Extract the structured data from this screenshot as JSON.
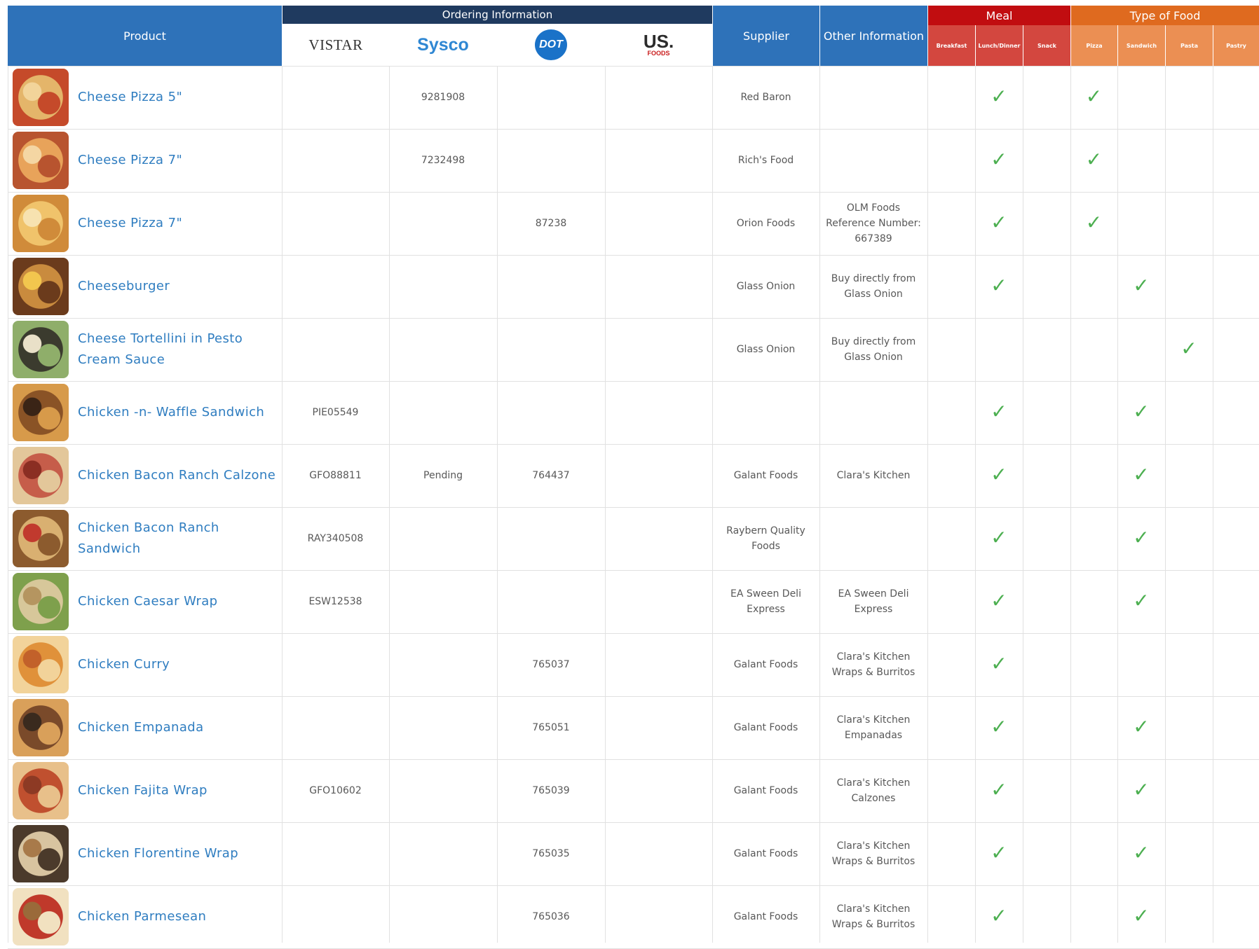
{
  "header": {
    "product": "Product",
    "ordering_information": "Ordering Information",
    "supplier": "Supplier",
    "other_information": "Other Information",
    "meal": "Meal",
    "type_of_food": "Type of Food",
    "vendors": {
      "vistar": "VISTAR",
      "sysco": "Sysco",
      "dot": "DOT",
      "usfoods_top": "US.",
      "usfoods_bottom": "FOODS"
    },
    "meal_columns": [
      "Breakfast",
      "Lunch/Dinner",
      "Snack"
    ],
    "food_columns": [
      "Pizza",
      "Sandwich",
      "Pasta",
      "Pastry"
    ]
  },
  "colors": {
    "blue_header": "#2e72b9",
    "dark_header": "#1f3a5f",
    "meal_red": "#c10d10",
    "food_orange": "#df6a1f",
    "product_text": "#2f7dc0",
    "check_green": "#4caf50"
  },
  "check_mark": "✓",
  "rows": [
    {
      "product": "Cheese Pizza 5\"",
      "image": "cheese-pizza-5-photo",
      "vistar": "",
      "sysco": "9281908",
      "dot": "",
      "usfoods": "",
      "supplier": "Red Baron",
      "other": "",
      "meal": [
        false,
        true,
        false
      ],
      "food": [
        true,
        false,
        false,
        false
      ]
    },
    {
      "product": "Cheese Pizza 7\"",
      "image": "cheese-pizza-7-photo",
      "vistar": "",
      "sysco": "7232498",
      "dot": "",
      "usfoods": "",
      "supplier": "Rich's Food",
      "other": "",
      "meal": [
        false,
        true,
        false
      ],
      "food": [
        true,
        false,
        false,
        false
      ]
    },
    {
      "product": "Cheese Pizza 7\"",
      "image": "cheese-pizza-7-slices-photo",
      "vistar": "",
      "sysco": "",
      "dot": "87238",
      "usfoods": "",
      "supplier": "Orion Foods",
      "other": "OLM Foods\nReference Number:\n667389",
      "meal": [
        false,
        true,
        false
      ],
      "food": [
        true,
        false,
        false,
        false
      ]
    },
    {
      "product": "Cheeseburger",
      "image": "cheeseburger-photo",
      "vistar": "",
      "sysco": "",
      "dot": "",
      "usfoods": "",
      "supplier": "Glass Onion",
      "other": "Buy directly from\nGlass Onion",
      "meal": [
        false,
        true,
        false
      ],
      "food": [
        false,
        true,
        false,
        false
      ]
    },
    {
      "product": "Cheese Tortellini in Pesto\nCream Sauce",
      "image": "tortellini-photo",
      "vistar": "",
      "sysco": "",
      "dot": "",
      "usfoods": "",
      "supplier": "Glass Onion",
      "other": "Buy directly from\nGlass Onion",
      "meal": [
        false,
        false,
        false
      ],
      "food": [
        false,
        false,
        true,
        false
      ]
    },
    {
      "product": "Chicken -n- Waffle Sandwich",
      "image": "chicken-waffle-photo",
      "vistar": "PIE05549",
      "sysco": "",
      "dot": "",
      "usfoods": "",
      "supplier": "",
      "other": "",
      "meal": [
        false,
        true,
        false
      ],
      "food": [
        false,
        true,
        false,
        false
      ]
    },
    {
      "product": "Chicken Bacon Ranch Calzone",
      "image": "calzone-photo",
      "vistar": "GFO88811",
      "sysco": "Pending",
      "dot": "764437",
      "usfoods": "",
      "supplier": "Galant Foods",
      "other": "Clara's Kitchen",
      "meal": [
        false,
        true,
        false
      ],
      "food": [
        false,
        true,
        false,
        false
      ]
    },
    {
      "product": "Chicken Bacon Ranch\nSandwich",
      "image": "bacon-ranch-sandwich-photo",
      "vistar": "RAY340508",
      "sysco": "",
      "dot": "",
      "usfoods": "",
      "supplier": "Raybern Quality\nFoods",
      "other": "",
      "meal": [
        false,
        true,
        false
      ],
      "food": [
        false,
        true,
        false,
        false
      ]
    },
    {
      "product": "Chicken Caesar Wrap",
      "image": "caesar-wrap-photo",
      "vistar": "ESW12538",
      "sysco": "",
      "dot": "",
      "usfoods": "",
      "supplier": "EA Sween Deli\nExpress",
      "other": "EA Sween Deli\nExpress",
      "meal": [
        false,
        true,
        false
      ],
      "food": [
        false,
        true,
        false,
        false
      ]
    },
    {
      "product": "Chicken Curry",
      "image": "chicken-curry-photo",
      "vistar": "",
      "sysco": "",
      "dot": "765037",
      "usfoods": "",
      "supplier": "Galant Foods",
      "other": "Clara's Kitchen\nWraps & Burritos",
      "meal": [
        false,
        true,
        false
      ],
      "food": [
        false,
        false,
        false,
        false
      ]
    },
    {
      "product": "Chicken Empanada",
      "image": "empanada-photo",
      "vistar": "",
      "sysco": "",
      "dot": "765051",
      "usfoods": "",
      "supplier": "Galant Foods",
      "other": "Clara's Kitchen\nEmpanadas",
      "meal": [
        false,
        true,
        false
      ],
      "food": [
        false,
        true,
        false,
        false
      ]
    },
    {
      "product": "Chicken Fajita Wrap",
      "image": "fajita-wrap-photo",
      "vistar": "GFO10602",
      "sysco": "",
      "dot": "765039",
      "usfoods": "",
      "supplier": "Galant Foods",
      "other": "Clara's Kitchen\nCalzones",
      "meal": [
        false,
        true,
        false
      ],
      "food": [
        false,
        true,
        false,
        false
      ]
    },
    {
      "product": "Chicken Florentine Wrap",
      "image": "florentine-wrap-photo",
      "vistar": "",
      "sysco": "",
      "dot": "765035",
      "usfoods": "",
      "supplier": "Galant Foods",
      "other": "Clara's Kitchen\nWraps & Burritos",
      "meal": [
        false,
        true,
        false
      ],
      "food": [
        false,
        true,
        false,
        false
      ]
    },
    {
      "product": "Chicken Parmesean",
      "image": "chicken-parmesean-photo",
      "vistar": "",
      "sysco": "",
      "dot": "765036",
      "usfoods": "",
      "supplier": "Galant Foods",
      "other": "Clara's Kitchen\nWraps & Burritos",
      "meal": [
        false,
        true,
        false
      ],
      "food": [
        false,
        true,
        false,
        false
      ]
    }
  ]
}
